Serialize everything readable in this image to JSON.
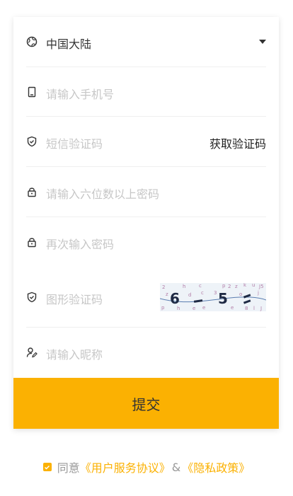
{
  "form": {
    "region": "中国大陆",
    "phone_placeholder": "请输入手机号",
    "sms_placeholder": "短信验证码",
    "get_code_label": "获取验证码",
    "password_placeholder": "请输入六位数以上密码",
    "confirm_placeholder": "再次输入密码",
    "captcha_placeholder": "图形验证码",
    "nickname_placeholder": "请输入昵称",
    "submit_label": "提交"
  },
  "agreement": {
    "prefix": "同意",
    "user_service": "《用户服务协议》",
    "amp": "&",
    "privacy": "《隐私政策》"
  },
  "colors": {
    "accent": "#fbb102",
    "placeholder": "#c7c7c7"
  }
}
